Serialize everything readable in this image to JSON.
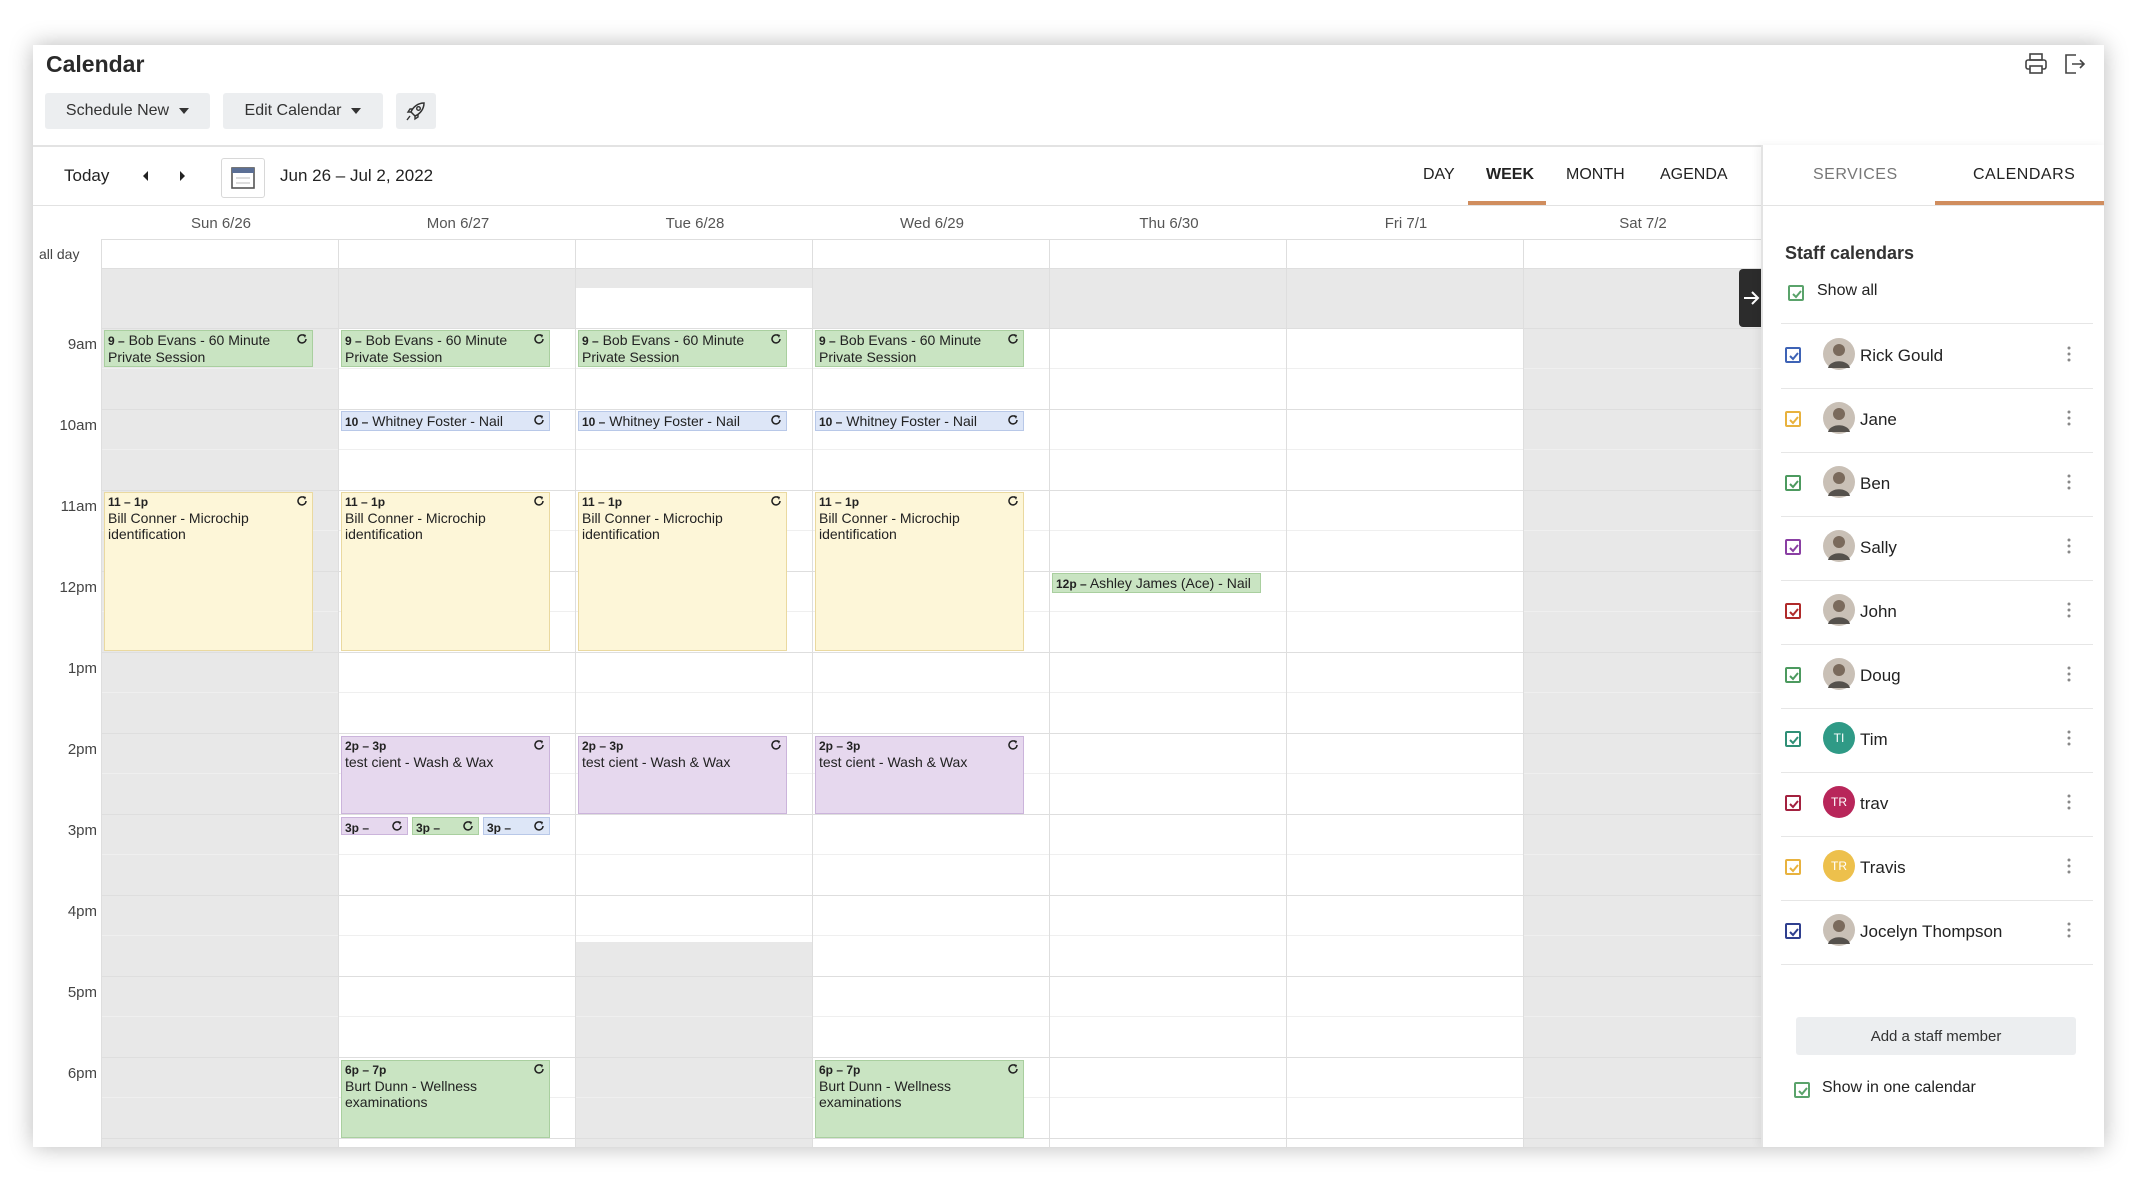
{
  "header": {
    "title": "Calendar",
    "schedule_new": "Schedule New",
    "edit_calendar": "Edit Calendar",
    "icons": [
      "print-icon",
      "exit-icon",
      "rocket-icon"
    ]
  },
  "toolbar": {
    "today": "Today",
    "range": "Jun 26 – Jul 2, 2022",
    "views": [
      "DAY",
      "WEEK",
      "MONTH",
      "AGENDA"
    ],
    "active_view": "WEEK"
  },
  "days": [
    "Sun 6/26",
    "Mon 6/27",
    "Tue 6/28",
    "Wed 6/29",
    "Thu 6/30",
    "Fri 7/1",
    "Sat 7/2"
  ],
  "all_day_label": "all day",
  "times": [
    "9am",
    "10am",
    "11am",
    "12pm",
    "1pm",
    "2pm",
    "3pm",
    "4pm",
    "5pm",
    "6pm"
  ],
  "events": {
    "bob_time": "9 –",
    "bob_title": "Bob Evans - 60 Minute Private Session",
    "whitney_time": "10 –",
    "whitney_title": "Whitney Foster - Nail",
    "bill_time": "11 – 1p",
    "bill_title": "Bill Conner - Microchip identification",
    "ashley_time": "12p –",
    "ashley_title": "Ashley James (Ace) - Nail",
    "wash_time": "2p – 3p",
    "wash_title": "test cient - Wash & Wax",
    "short_time": "3p –",
    "burt_time": "6p – 7p",
    "burt_title": "Burt Dunn - Wellness examinations"
  },
  "side": {
    "tabs": [
      "SERVICES",
      "CALENDARS"
    ],
    "active_tab": "CALENDARS",
    "heading": "Staff calendars",
    "show_all": "Show all",
    "staff": [
      {
        "name": "Rick Gould",
        "color": "#3e63b6",
        "avatar": "photo"
      },
      {
        "name": "Jane",
        "color": "#e8b23e",
        "avatar": "photo"
      },
      {
        "name": "Ben",
        "color": "#4c9a5f",
        "avatar": "photo"
      },
      {
        "name": "Sally",
        "color": "#8a3fa3",
        "avatar": "photo"
      },
      {
        "name": "John",
        "color": "#b02a2a",
        "avatar": "photo"
      },
      {
        "name": "Doug",
        "color": "#4c9a5f",
        "avatar": "photo"
      },
      {
        "name": "Tim",
        "color": "#2f8f76",
        "avatar": "TI",
        "avatar_color": "#2f9a86"
      },
      {
        "name": "trav",
        "color": "#a3213f",
        "avatar": "TR",
        "avatar_color": "#b8265a"
      },
      {
        "name": "Travis",
        "color": "#e8b23e",
        "avatar": "TR",
        "avatar_color": "#edc04c"
      },
      {
        "name": "Jocelyn Thompson",
        "color": "#2f3f8f",
        "avatar": "photo"
      }
    ],
    "add_staff": "Add a staff member",
    "show_in_one": "Show in one calendar"
  },
  "colors": {
    "accent": "#d08d5e",
    "check_green": "#5aa36b"
  }
}
